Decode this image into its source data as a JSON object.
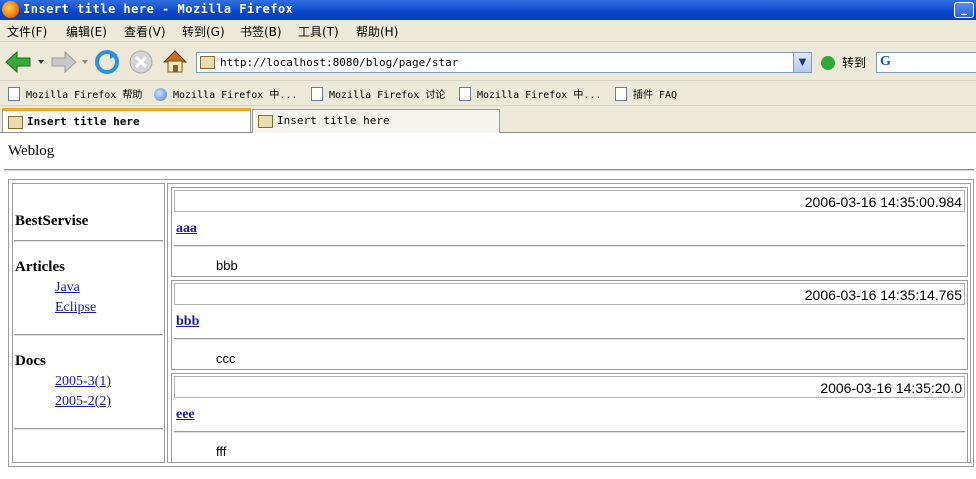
{
  "window": {
    "title": "Insert title here - Mozilla Firefox",
    "minimize_label": "_"
  },
  "menu": [
    "文件(F)",
    "编辑(E)",
    "查看(V)",
    "转到(G)",
    "书签(B)",
    "工具(T)",
    "帮助(H)"
  ],
  "toolbar": {
    "url": "http://localhost:8080/blog/page/star",
    "go_label": "转到",
    "search_logo": "G"
  },
  "bookmarks": [
    "Mozilla Firefox 帮助",
    "Mozilla Firefox 中...",
    "Mozilla Firefox 讨论",
    "Mozilla Firefox 中...",
    "插件 FAQ"
  ],
  "tabs": [
    "Insert title here",
    "Insert title here"
  ],
  "page": {
    "site_title": "Weblog",
    "sidebar": {
      "heading": "BestServise",
      "articles_heading": "Articles",
      "articles": [
        "Java",
        "Eclipse"
      ],
      "docs_heading": "Docs",
      "docs": [
        "2005-3(1)",
        "2005-2(2)"
      ]
    },
    "posts": [
      {
        "date": "2006-03-16 14:35:00.984",
        "title": "aaa",
        "body": "bbb"
      },
      {
        "date": "2006-03-16 14:35:14.765",
        "title": "bbb",
        "body": "ccc"
      },
      {
        "date": "2006-03-16 14:35:20.0",
        "title": "eee",
        "body": "fff"
      }
    ]
  },
  "colors": {
    "titlebar": "#0a47c9",
    "chrome": "#ece9d8",
    "link": "#1a1aa6",
    "active_tab_accent": "#f5a623"
  }
}
